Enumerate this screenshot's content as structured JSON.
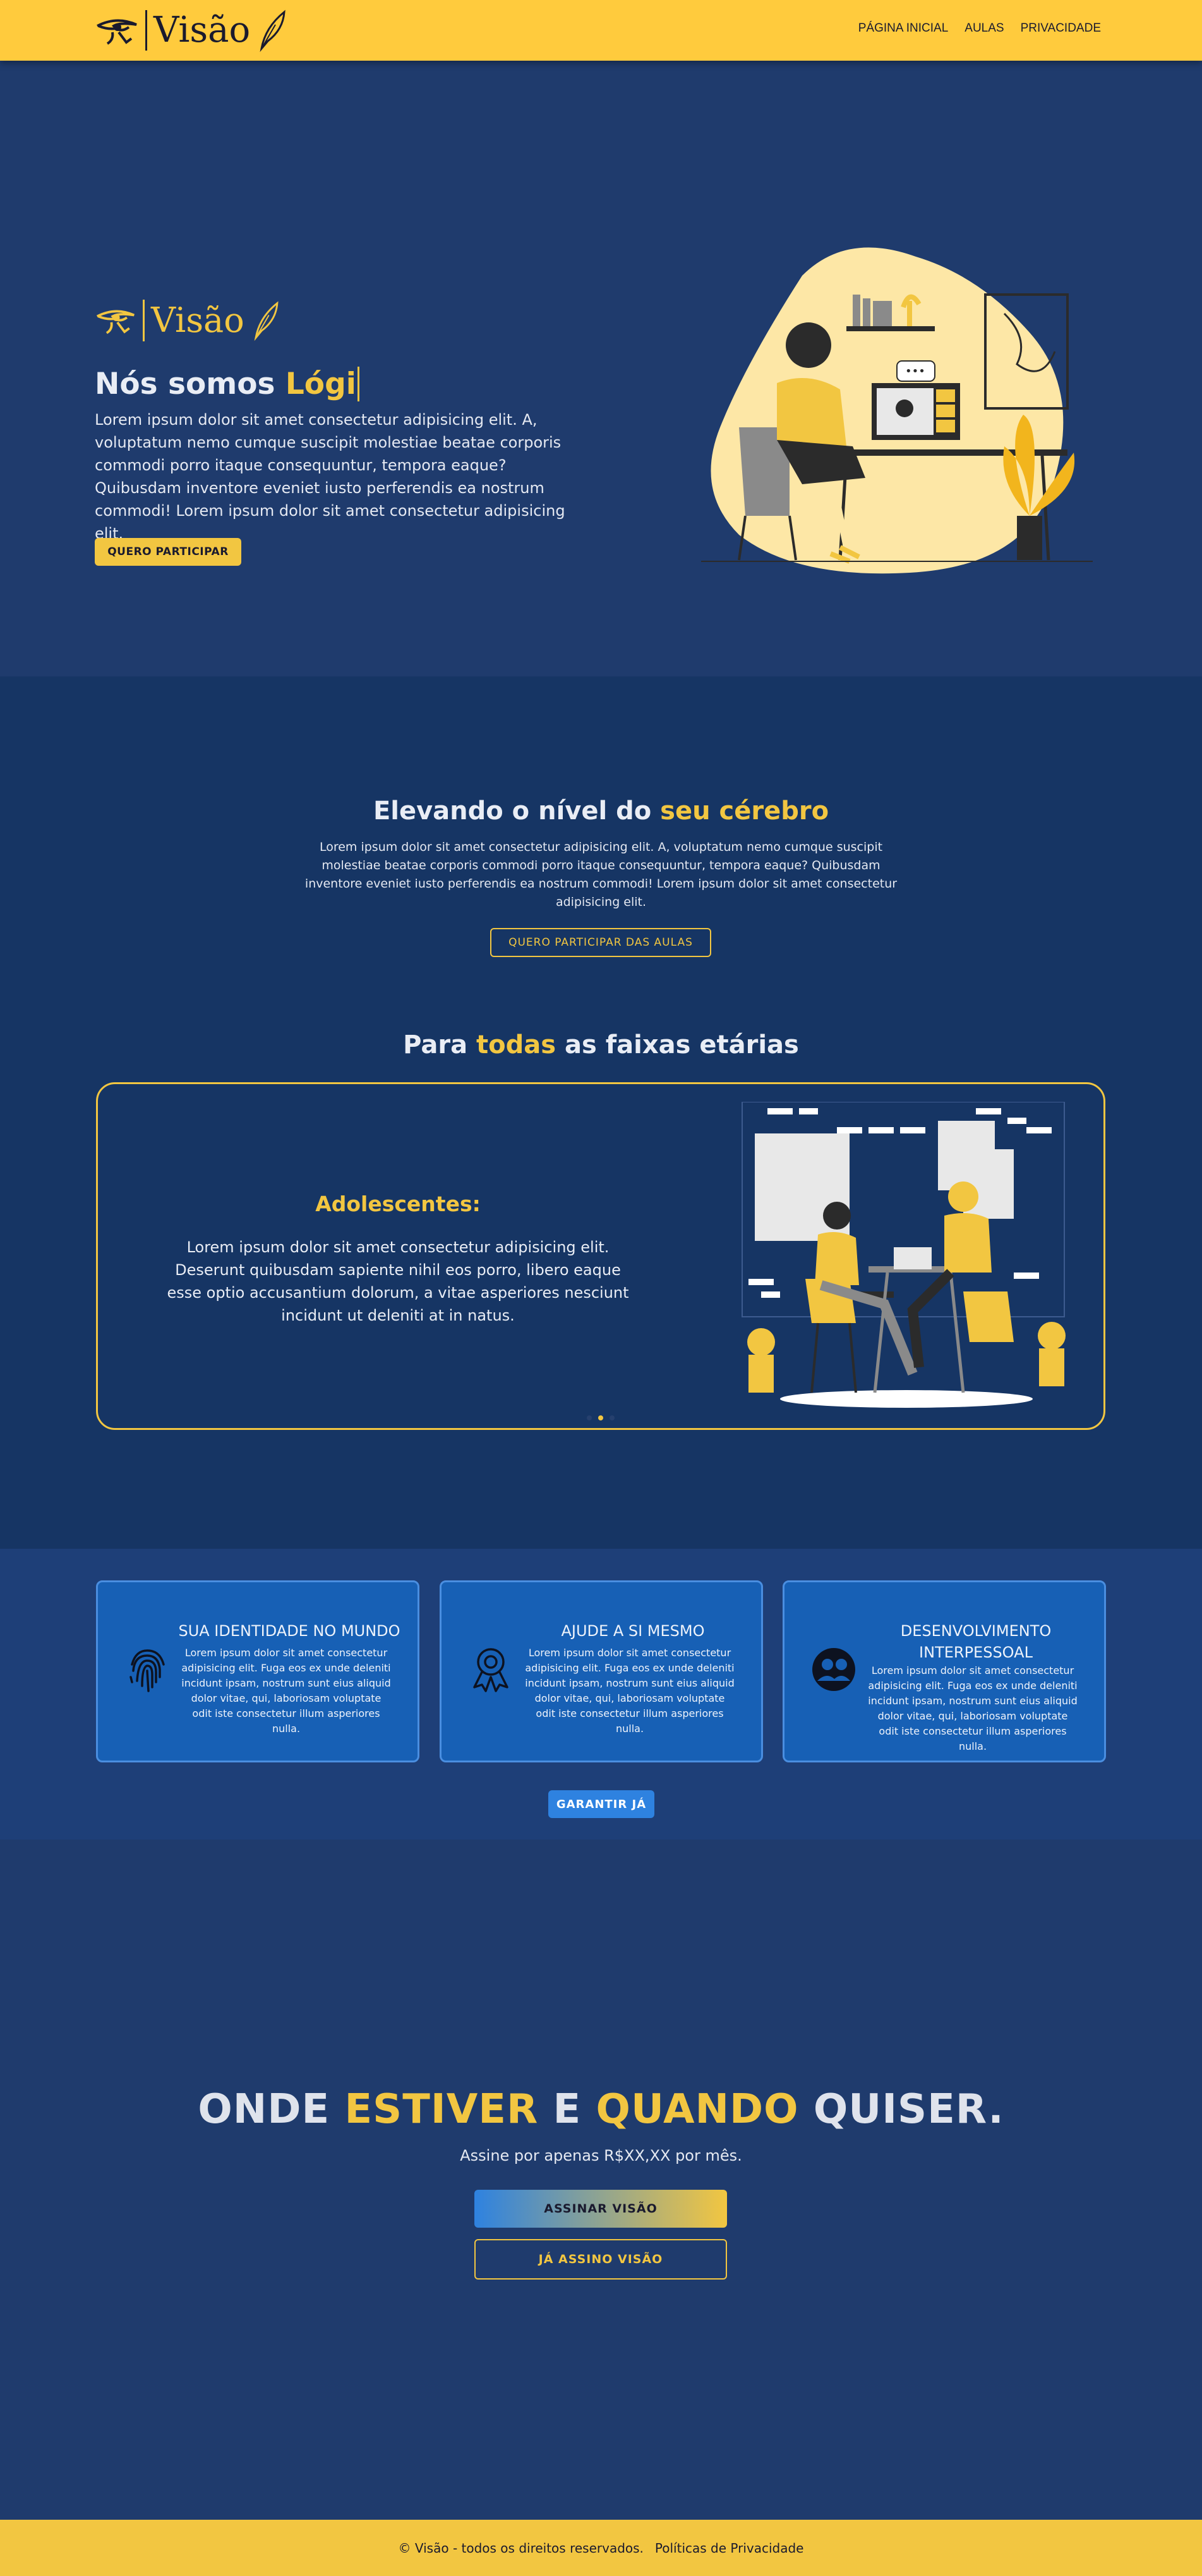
{
  "brand": {
    "name": "Visão"
  },
  "nav": {
    "items": [
      "PÁGINA INICIAL",
      "AULAS",
      "PRIVACIDADE"
    ]
  },
  "hero": {
    "title_prefix": "Nós somos",
    "title_highlight": "Lógi",
    "text": "Lorem ipsum dolor sit amet consectetur adipisicing elit. A, voluptatum nemo cumque suscipit molestiae beatae corporis commodi porro itaque consequuntur, tempora eaque? Quibusdam inventore eveniet iusto perferendis ea nostrum commodi! Lorem ipsum dolor sit amet consectetur adipisicing elit.",
    "cta": "QUERO PARTICIPAR"
  },
  "level": {
    "title_prefix": "Elevando o nível do",
    "title_highlight": "seu cérebro",
    "text": "Lorem ipsum dolor sit amet consectetur adipisicing elit. A, voluptatum nemo cumque suscipit molestiae beatae corporis commodi porro itaque consequuntur, tempora eaque? Quibusdam inventore eveniet iusto perferendis ea nostrum commodi! Lorem ipsum dolor sit amet consectetur adipisicing elit.",
    "cta": "QUERO PARTICIPAR DAS AULAS"
  },
  "ages": {
    "title_prefix": "Para",
    "title_highlight": "todas",
    "title_suffix": "as faixas etárias",
    "slide_title": "Adolescentes:",
    "slide_text": "Lorem ipsum dolor sit amet consectetur adipisicing elit. Deserunt quibusdam sapiente nihil eos porro, libero eaque esse optio accusantium dolorum, a vitae asperiores nesciunt incidunt ut deleniti at in natus."
  },
  "features": [
    {
      "icon": "fingerprint-icon",
      "title": "SUA IDENTIDADE NO MUNDO",
      "text": "Lorem ipsum dolor sit amet consectetur adipisicing elit. Fuga eos ex unde deleniti incidunt ipsam, nostrum sunt eius aliquid dolor vitae, qui, laboriosam voluptate odit iste consectetur illum asperiores nulla."
    },
    {
      "icon": "award-icon",
      "title": "AJUDE A SI MESMO",
      "text": "Lorem ipsum dolor sit amet consectetur adipisicing elit. Fuga eos ex unde deleniti incidunt ipsam, nostrum sunt eius aliquid dolor vitae, qui, laboriosam voluptate odit iste consectetur illum asperiores nulla."
    },
    {
      "icon": "people-icon",
      "title": "DESENVOLVIMENTO INTERPESSOAL",
      "text": "Lorem ipsum dolor sit amet consectetur adipisicing elit. Fuga eos ex unde deleniti incidunt ipsam, nostrum sunt eius aliquid dolor vitae, qui, laboriosam voluptate odit iste consectetur illum asperiores nulla."
    }
  ],
  "features_cta": "GARANTIR JÁ",
  "subscribe": {
    "w1": "ONDE",
    "w2": "ESTIVER",
    "w3": "E",
    "w4": "QUANDO",
    "w5": "QUISER.",
    "text": "Assine por apenas R$XX,XX por mês.",
    "cta_primary": "ASSINAR VISÃO",
    "cta_secondary": "JÁ ASSINO VISÃO"
  },
  "footer": {
    "copyright": "© Visão - todos os direitos reservados.",
    "privacy": "Políticas de Privacidade"
  },
  "colors": {
    "yellow": "#f2c641",
    "navy": "#1f3b6d",
    "blue": "#1760b5"
  }
}
